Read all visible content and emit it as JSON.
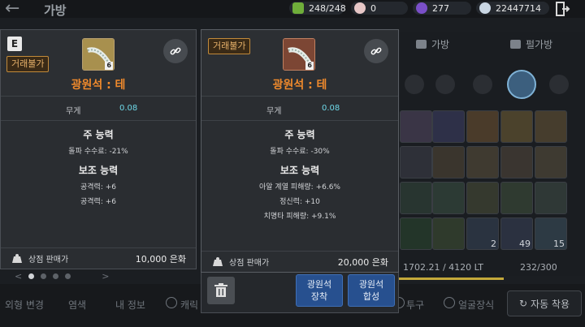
{
  "header": {
    "title": "가방",
    "resources": [
      {
        "icon": "energy-icon",
        "value": "248/248",
        "color": "#6fae3a"
      },
      {
        "icon": "pearl-icon",
        "value": "0",
        "color": "#e7c7c7"
      },
      {
        "icon": "crystal-icon",
        "value": "277",
        "color": "#7a4fc8"
      },
      {
        "icon": "silver-icon",
        "value": "22447714",
        "color": "#c9d6e3"
      }
    ]
  },
  "background": {
    "tabs": [
      "가방",
      "펄가방"
    ],
    "pager_prev": "<",
    "pager_next": ">",
    "slot_counts": [
      "2",
      "49",
      "15"
    ],
    "weight": "1702.21 / 4120 LT",
    "slots": "232/300",
    "bottom_tabs": [
      "외형 변경",
      "염색",
      "내 정보",
      "캐릭",
      "투구",
      "얼굴장식"
    ],
    "auto_button": "자동 착용"
  },
  "left_card": {
    "grade": "E",
    "trade": "거래불가",
    "item_level": "6",
    "name": "광원석 : 테",
    "name_color": "#f08a2c",
    "weight_label": "무게",
    "weight_value": "0.08",
    "main_title": "주 능력",
    "main_lines": [
      "돌파 수수료: -21%"
    ],
    "sub_title": "보조 능력",
    "sub_lines": [
      "공격력: +6",
      "공격력: +6"
    ],
    "sell_label": "상점 판매가",
    "sell_price": "10,000 은화"
  },
  "right_card": {
    "trade": "거래불가",
    "item_level": "6",
    "name": "광원석 : 테",
    "name_color": "#f08a2c",
    "weight_label": "무게",
    "weight_value": "0.08",
    "main_title": "주 능력",
    "main_lines": [
      "돌파 수수료: -30%"
    ],
    "sub_title": "보조 능력",
    "sub_lines": [
      "아알 계열 피해량: +6.6%",
      "정신력: +10",
      "치명타 피해량: +9.1%"
    ],
    "sell_label": "상점 판매가",
    "sell_price": "20,000 은화"
  },
  "actions": {
    "equip_line1": "광원석",
    "equip_line2": "장착",
    "combine_line1": "광원석",
    "combine_line2": "합성"
  }
}
